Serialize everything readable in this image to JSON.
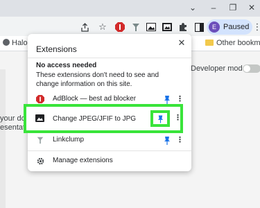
{
  "browser": {
    "profile_initial": "E",
    "profile_status": "Paused",
    "toolbar_icons": [
      "share-icon",
      "star-icon",
      "adblock-icon",
      "linkclump-icon",
      "image-converter-icon",
      "extensions-puzzle-icon",
      "side-panel-icon"
    ]
  },
  "bookmarks": {
    "left_item": "Halo",
    "right_item": "Other bookmark"
  },
  "background_page": {
    "developer_mode_label": "Developer mode",
    "left_text_1": "your doc",
    "left_text_2": "esentati"
  },
  "extensions_popup": {
    "title": "Extensions",
    "section_heading": "No access needed",
    "section_description": "These extensions don't need to see and change information on this site.",
    "items": [
      {
        "name": "AdBlock — best ad blocker",
        "icon": "adblock-icon",
        "pinned": true
      },
      {
        "name": "Change JPEG/JFIF to JPG",
        "icon": "image-icon",
        "pinned": true
      },
      {
        "name": "Linkclump",
        "icon": "linkclump-icon",
        "pinned": true
      }
    ],
    "manage_label": "Manage extensions"
  },
  "colors": {
    "highlight": "#39e43a",
    "pin": "#1a73e8",
    "adblock": "#d22b2b",
    "profile_chip": "#d3e3fd"
  }
}
